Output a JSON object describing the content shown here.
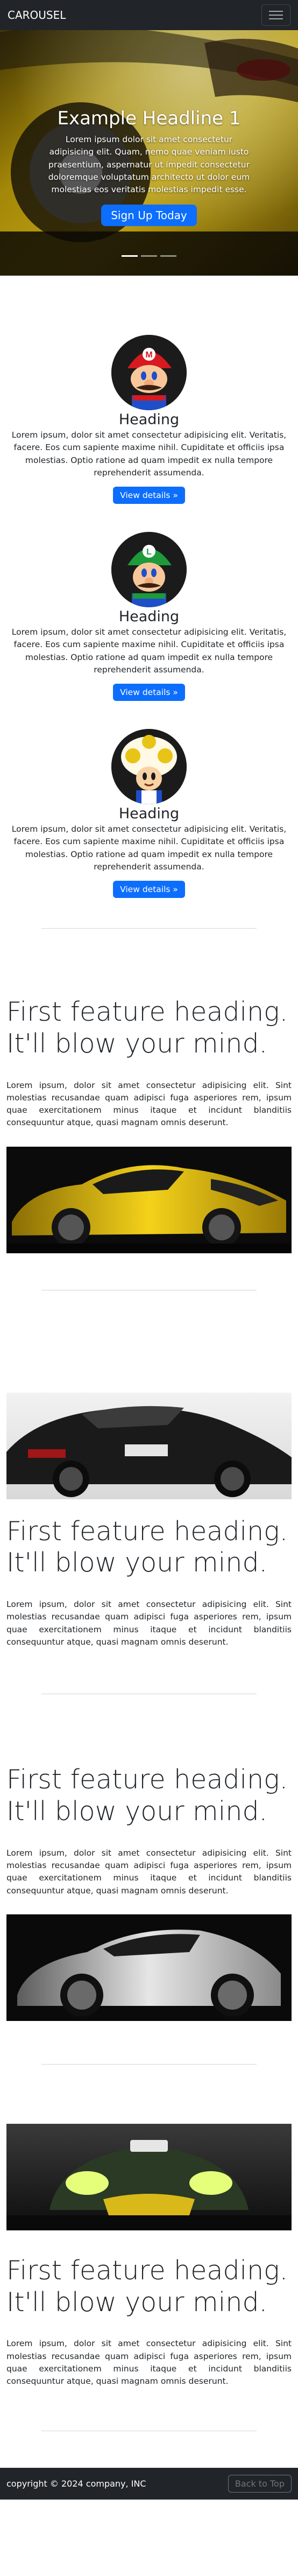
{
  "navbar": {
    "brand": "CAROUSEL"
  },
  "hero": {
    "title": "Example Headline 1",
    "text": "Lorem ipsum dolor sit amet consectetur adipisicing elit. Quam, nemo quae veniam iusto praesentium, aspernatur ut impedit consectetur doloremque voluptatum architecto ut dolor eum molestias eos veritatis molestias impedit esse.",
    "button": "Sign Up Today",
    "indicator_count": 3,
    "active_indicator": 0
  },
  "marketing": [
    {
      "heading": "Heading",
      "text": "Lorem ipsum, dolor sit amet consectetur adipisicing elit. Veritatis, facere. Eos cum sapiente maxime nihil. Cupiditate et officiis ipsa molestias. Optio ratione ad quam impedit ex nulla tempore reprehenderit assumenda.",
      "button": "View details »",
      "avatar": "mario-avatar"
    },
    {
      "heading": "Heading",
      "text": "Lorem ipsum, dolor sit amet consectetur adipisicing elit. Veritatis, facere. Eos cum sapiente maxime nihil. Cupiditate et officiis ipsa molestias. Optio ratione ad quam impedit ex nulla tempore reprehenderit assumenda.",
      "button": "View details »",
      "avatar": "luigi-avatar"
    },
    {
      "heading": "Heading",
      "text": "Lorem ipsum, dolor sit amet consectetur adipisicing elit. Veritatis, facere. Eos cum sapiente maxime nihil. Cupiditate et officiis ipsa molestias. Optio ratione ad quam impedit ex nulla tempore reprehenderit assumenda.",
      "button": "View details »",
      "avatar": "toad-avatar"
    }
  ],
  "features": [
    {
      "heading_line1": "First feature heading.",
      "heading_line2": "It'll blow your mind.",
      "text": "Lorem ipsum, dolor sit amet consectetur adipisicing elit. Sint molestias recusandae quam adipisci fuga asperiores rem, ipsum quae exercitationem minus itaque et incidunt blanditiis consequuntur atque, quasi magnam omnis deserunt.",
      "image": "yellow-sports-car"
    },
    {
      "heading_line1": "First feature heading.",
      "heading_line2": "It'll blow your mind.",
      "text": "Lorem ipsum, dolor sit amet consectetur adipisicing elit. Sint molestias recusandae quam adipisci fuga asperiores rem, ipsum quae exercitationem minus itaque et incidunt blanditiis consequuntur atque, quasi magnam omnis deserunt.",
      "image": "black-coupe"
    },
    {
      "heading_line1": "First feature heading.",
      "heading_line2": "It'll blow your mind.",
      "text": "Lorem ipsum, dolor sit amet consectetur adipisicing elit. Sint molestias recusandae quam adipisci fuga asperiores rem, ipsum quae exercitationem minus itaque et incidunt blanditiis consequuntur atque, quasi magnam omnis deserunt.",
      "image": "silver-gtr"
    },
    {
      "heading_line1": "First feature heading.",
      "heading_line2": "It'll blow your mind.",
      "text": "Lorem ipsum, dolor sit amet consectetur adipisicing elit. Sint molestias recusandae quam adipisci fuga asperiores rem, ipsum quae exercitationem minus itaque et incidunt blanditiis consequuntur atque, quasi magnam omnis deserunt.",
      "image": "race-car-front"
    }
  ],
  "footer": {
    "copyright": "copyright © 2024 company, INC",
    "back_to_top": "Back to Top"
  },
  "colors": {
    "navbar": "#212529",
    "primary": "#0d6efd",
    "text": "#212529",
    "muted": "#6c757d"
  }
}
